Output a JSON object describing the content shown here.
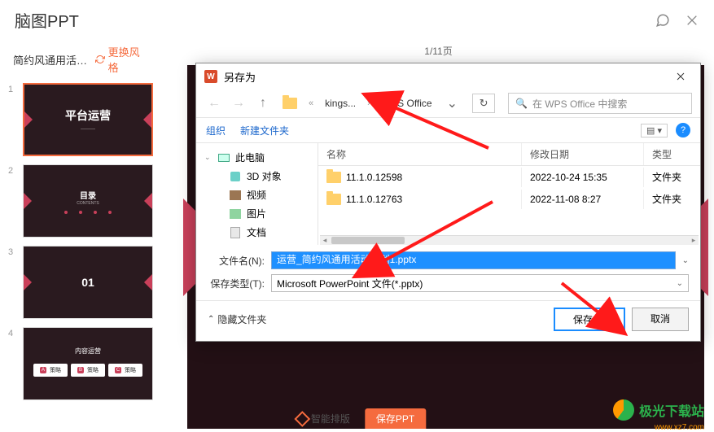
{
  "app": {
    "title": "脑图PPT"
  },
  "sidebar": {
    "doc_title": "简约风通用活动...",
    "change_style": "更换风格",
    "thumbs": [
      {
        "num": "1",
        "title": "平台运营"
      },
      {
        "num": "2",
        "title": "目录",
        "sub": "CONTENTS"
      },
      {
        "num": "3",
        "title": "01"
      },
      {
        "num": "4",
        "title": "内容运营",
        "cards": [
          "A 策略",
          "B 策略",
          "C 策略"
        ]
      }
    ]
  },
  "main": {
    "page_counter": "1/11页"
  },
  "dialog": {
    "title": "另存为",
    "crumbs": {
      "folder1": "kings...",
      "folder2": "WPS Office"
    },
    "search_placeholder": "在 WPS Office 中搜索",
    "toolbar": {
      "organize": "组织",
      "new_folder": "新建文件夹"
    },
    "tree": {
      "this_pc": "此电脑",
      "objects3d": "3D 对象",
      "videos": "视频",
      "pictures": "图片",
      "documents": "文档"
    },
    "columns": {
      "name": "名称",
      "date": "修改日期",
      "type": "类型"
    },
    "rows": [
      {
        "name": "11.1.0.12598",
        "date": "2022-10-24 15:35",
        "type": "文件夹"
      },
      {
        "name": "11.1.0.12763",
        "date": "2022-11-08 8:27",
        "type": "文件夹"
      }
    ],
    "filename_label": "文件名(N):",
    "filename_value": "运营_简约风通用活动策划1.pptx",
    "filetype_label": "保存类型(T):",
    "filetype_value": "Microsoft PowerPoint 文件(*.pptx)",
    "hide_folders": "隐藏文件夹",
    "save": "保存(S)",
    "cancel": "取消"
  },
  "bottom": {
    "smart_layout": "智能排版",
    "save_ppt": "保存PPT"
  },
  "watermark": {
    "text": "极光下载站",
    "url": "www.xz7.com"
  }
}
